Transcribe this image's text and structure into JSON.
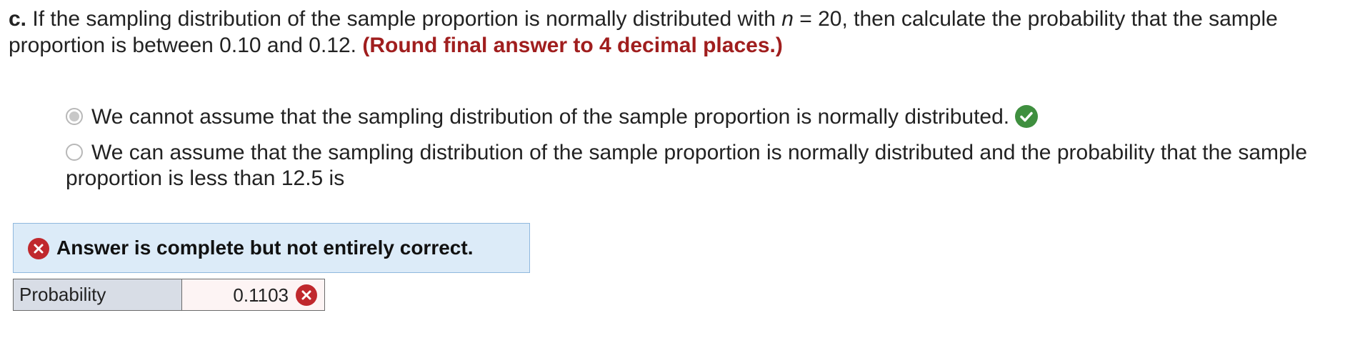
{
  "question": {
    "part_label": "c.",
    "text_before": " If the sampling distribution of the sample proportion is normally distributed with ",
    "variable": "n",
    "text_equals": " = 20, then calculate the probability that the sample proportion is between 0.10 and 0.12. ",
    "rounding_note": "(Round final answer to 4 decimal places.)"
  },
  "options": [
    {
      "label": "We cannot assume that the sampling distribution of the sample proportion is normally distributed.",
      "selected": true,
      "status": "correct"
    },
    {
      "label": "We can assume that the sampling distribution of the sample proportion is normally distributed and the probability that the sample proportion is less than 12.5 is",
      "selected": false
    }
  ],
  "feedback": {
    "message": "Answer is complete but not entirely correct.",
    "status": "incorrect"
  },
  "answer_table": {
    "label": "Probability",
    "value": "0.1103",
    "status": "incorrect"
  },
  "colors": {
    "note_red": "#a01e1e",
    "correct_green": "#3f8f3f",
    "incorrect_red": "#c0282d",
    "feedback_bg": "#dcebf8",
    "label_cell_bg": "#d8dde6"
  },
  "icons": {
    "correct": "check-icon",
    "incorrect": "close-icon"
  }
}
